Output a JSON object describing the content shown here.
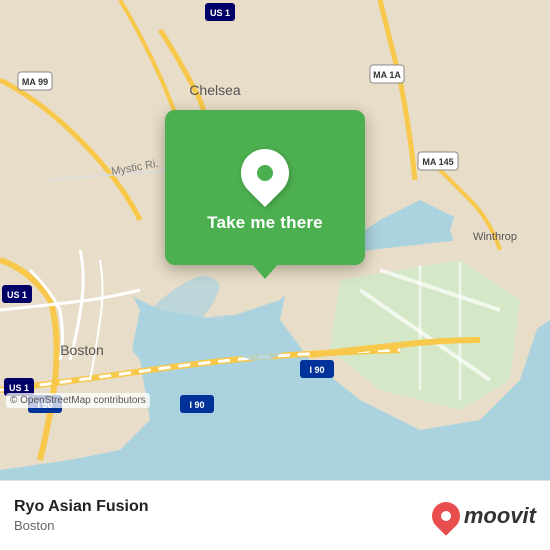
{
  "map": {
    "attribution": "© OpenStreetMap contributors",
    "background_color": "#aad3df"
  },
  "popup": {
    "button_label": "Take me there",
    "pin_icon": "location-pin"
  },
  "bottom_bar": {
    "location_name": "Ryo Asian Fusion",
    "location_city": "Boston",
    "logo_text": "moovit"
  },
  "road_colors": {
    "major": "#f7c849",
    "minor": "#ffffff",
    "highway": "#e8a020"
  }
}
